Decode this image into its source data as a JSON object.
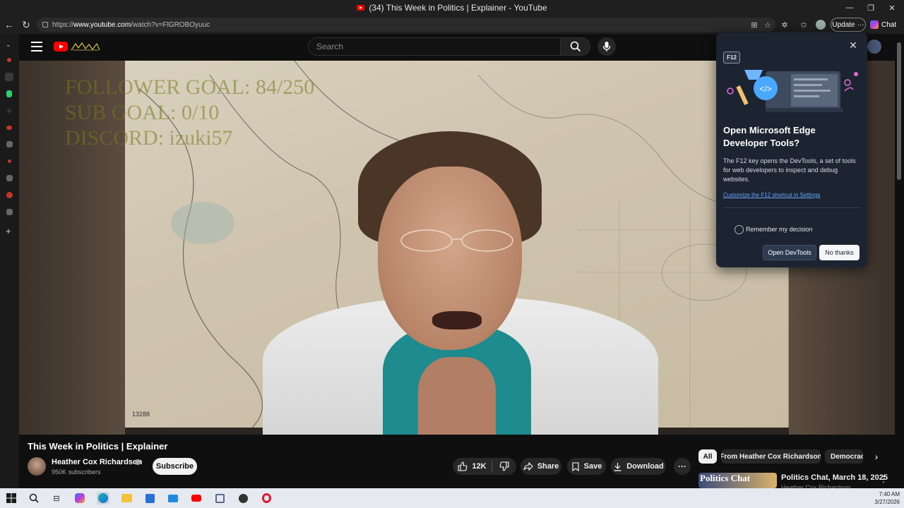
{
  "window": {
    "title": "(34) This Week in Politics | Explainer - YouTube",
    "controls": [
      "—",
      "❐",
      "✕"
    ]
  },
  "browser": {
    "url_prefix": "https://",
    "url_host": "www.youtube.com",
    "url_path": "/watch?v=FlGROBOyuuc",
    "update_label": "Update",
    "chat_label": "Chat"
  },
  "youtube": {
    "search_placeholder": "Search",
    "video": {
      "overlay_lines": [
        "FOLLOWER GOAL:  84/250",
        "SUB GOAL: 0/10",
        "DISCORD: izuki57"
      ],
      "chart_number": "13288"
    },
    "title": "This Week in Politics | Explainer",
    "channel": {
      "name": "Heather Cox Richardson",
      "subscribers": "950K subscribers",
      "subscribe_label": "Subscribe"
    },
    "actions": {
      "likes": "12K",
      "share": "Share",
      "save": "Save",
      "download": "Download"
    },
    "chips": [
      "All",
      "From Heather Cox Richardson",
      "Democracy"
    ],
    "recommended": {
      "thumb_text": "Politics Chat",
      "title": "Politics Chat, March 18, 2025",
      "channel": "Heather Cox Richardson"
    }
  },
  "devtools_popup": {
    "key_label": "F12",
    "title": "Open Microsoft Edge Developer Tools?",
    "body": "The F12 key opens the DevTools, a set of tools for web developers to inspect and debug websites.",
    "link": "Customize the F12 shortcut in Settings",
    "remember": "Remember my decision",
    "open_button": "Open DevTools",
    "decline_button": "No thanks"
  },
  "taskbar": {
    "time": "7:40 AM",
    "date": "3/27/2026"
  },
  "colors": {
    "youtube_red": "#ff0000",
    "link_blue": "#6aa7ff",
    "popup_bg": "#1c2431"
  }
}
